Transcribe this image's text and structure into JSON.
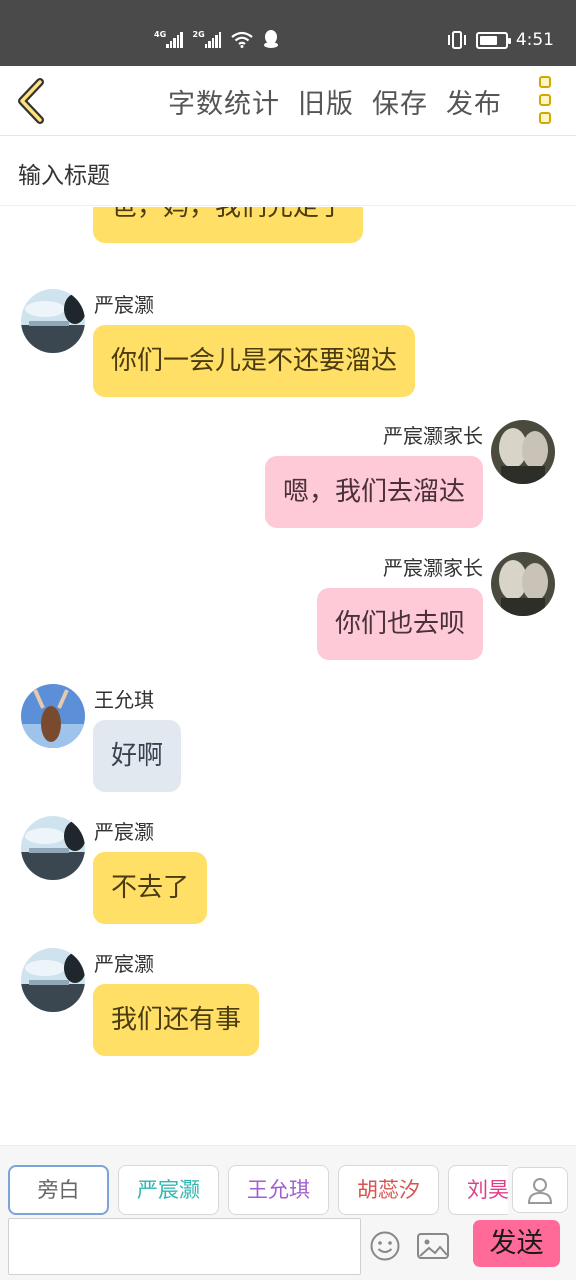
{
  "status_bar": {
    "net1": "4G",
    "net2": "2G",
    "time": "4:51",
    "battery_level": 0.7
  },
  "toolbar": {
    "back_icon": "chevron-left-icon",
    "actions": [
      "字数统计",
      "旧版",
      "保存",
      "发布"
    ],
    "more_icon": "more-vertical-icon",
    "accent": "#d2a800"
  },
  "title_input": {
    "placeholder": "输入标题"
  },
  "messages": [
    {
      "side": "left",
      "name": "",
      "text": "爸，妈，我们先走了",
      "color": "yellow",
      "avatar": "sky-lake-avatar"
    },
    {
      "side": "left",
      "name": "严宸灏",
      "text": "你们一会儿是不还要溜达",
      "color": "yellow",
      "avatar": "sky-lake-avatar"
    },
    {
      "side": "right",
      "name": "严宸灏家长",
      "text": "嗯，我们去溜达",
      "color": "pink",
      "avatar": "anime-couple-avatar"
    },
    {
      "side": "right",
      "name": "严宸灏家长",
      "text": "你们也去呗",
      "color": "pink",
      "avatar": "anime-couple-avatar"
    },
    {
      "side": "left",
      "name": "王允琪",
      "text": "好啊",
      "color": "grey",
      "avatar": "girl-sky-avatar"
    },
    {
      "side": "left",
      "name": "严宸灏",
      "text": "不去了",
      "color": "yellow",
      "avatar": "sky-lake-avatar"
    },
    {
      "side": "left",
      "name": "严宸灏",
      "text": "我们还有事",
      "color": "yellow",
      "avatar": "sky-lake-avatar"
    }
  ],
  "bubble_colors": {
    "yellow": "#ffdf66",
    "pink": "#ffcad8",
    "grey": "#e2e8f0"
  },
  "role_bar": {
    "roles": [
      {
        "label": "旁白",
        "color": "#666666",
        "active": true
      },
      {
        "label": "严宸灏",
        "color": "#2bb8b0",
        "active": false
      },
      {
        "label": "王允琪",
        "color": "#a25fd0",
        "active": false
      },
      {
        "label": "胡蕊汐",
        "color": "#d9534f",
        "active": false
      },
      {
        "label": "刘昊铭",
        "color": "#e0408a",
        "active": false
      }
    ],
    "person_icon": "person-icon"
  },
  "composer": {
    "input_value": "",
    "emoji_icon": "emoji-icon",
    "image_icon": "image-icon",
    "send_label": "发送",
    "send_color": "#ff6a99"
  }
}
